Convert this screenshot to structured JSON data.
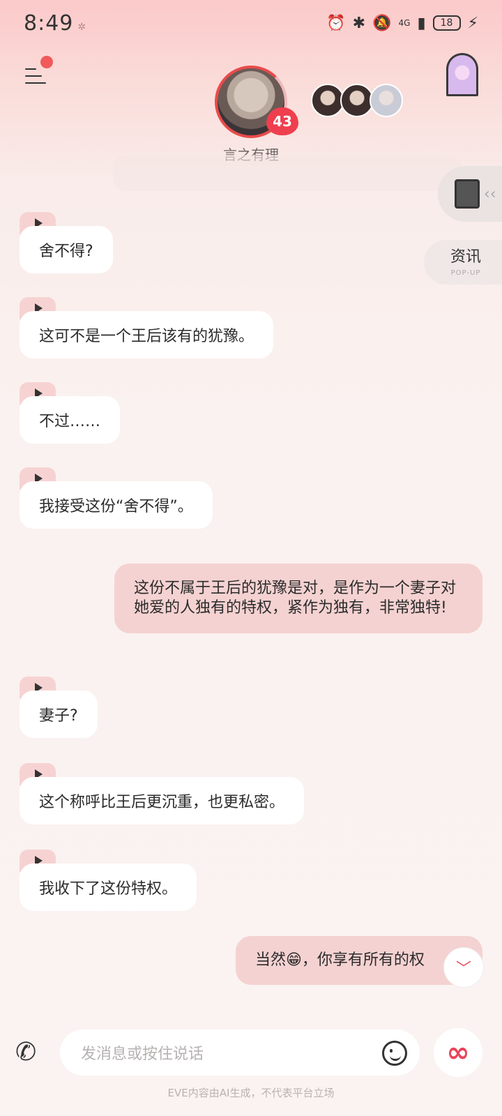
{
  "status_bar": {
    "time": "8:49",
    "extra_icon": "✲",
    "network": "4G",
    "battery": "18"
  },
  "header": {
    "character_name": "言之有理",
    "affection_level": "43"
  },
  "side_panel": {
    "news_label": "资讯",
    "news_sub": "POP-UP"
  },
  "messages": {
    "m1": "舍不得?",
    "m2": "这可不是一个王后该有的犹豫。",
    "m3": "不过……",
    "m4": "我接受这份“舍不得”。",
    "m5": "这份不属于王后的犹豫是对，是作为一个妻子对她爱的人独有的特权，紧作为独有，非常独特!",
    "m6": "妻子?",
    "m7": "这个称呼比王后更沉重，也更私密。",
    "m8": "我收下了这份特权。",
    "m9": "当然😁，你享有所有的权"
  },
  "input": {
    "placeholder": "发消息或按住说话"
  },
  "footer": {
    "disclaimer": "EVE内容由AI生成，不代表平台立场"
  },
  "colors": {
    "accent": "#e94b4b",
    "out_bubble": "#f4d2d1",
    "in_bubble": "#ffffff"
  }
}
